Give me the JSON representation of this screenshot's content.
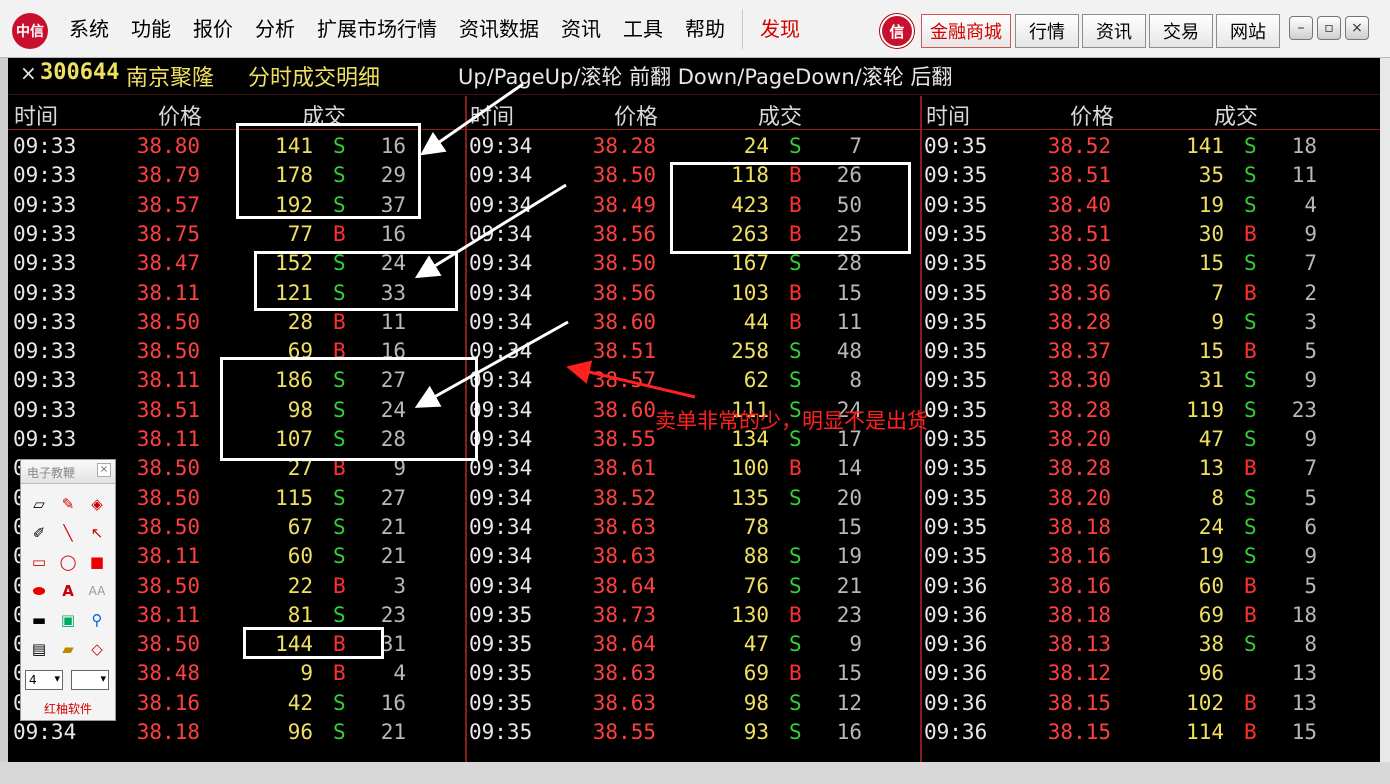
{
  "menubar": {
    "logo": "中信",
    "items": [
      "系统",
      "功能",
      "报价",
      "分析",
      "扩展市场行情",
      "资讯数据",
      "资讯",
      "工具",
      "帮助"
    ],
    "discover": "发现",
    "red_logo": "信",
    "buttons": [
      "金融商城",
      "行情",
      "资讯",
      "交易",
      "网站"
    ],
    "window_controls": [
      "minimize-icon",
      "maximize-icon",
      "close-icon"
    ]
  },
  "panel": {
    "close": "×",
    "stock_code": "300644",
    "stock_name": "南京聚隆",
    "title": "分时成交明细",
    "hint": "Up/PageUp/滚轮 前翻 Down/PageDown/滚轮 后翻",
    "headers": {
      "time": "时间",
      "price": "价格",
      "volume": "成交"
    },
    "columns": [
      [
        [
          "09:33",
          "38.80",
          "141",
          "S",
          "16"
        ],
        [
          "09:33",
          "38.79",
          "178",
          "S",
          "29"
        ],
        [
          "09:33",
          "38.57",
          "192",
          "S",
          "37"
        ],
        [
          "09:33",
          "38.75",
          "77",
          "B",
          "16"
        ],
        [
          "09:33",
          "38.47",
          "152",
          "S",
          "24"
        ],
        [
          "09:33",
          "38.11",
          "121",
          "S",
          "33"
        ],
        [
          "09:33",
          "38.50",
          "28",
          "B",
          "11"
        ],
        [
          "09:33",
          "38.50",
          "69",
          "B",
          "16"
        ],
        [
          "09:33",
          "38.11",
          "186",
          "S",
          "27"
        ],
        [
          "09:33",
          "38.51",
          "98",
          "S",
          "24"
        ],
        [
          "09:33",
          "38.11",
          "107",
          "S",
          "28"
        ],
        [
          "09:33",
          "38.50",
          "27",
          "B",
          "9"
        ],
        [
          "09:33",
          "38.50",
          "115",
          "S",
          "27"
        ],
        [
          "09:33",
          "38.50",
          "67",
          "S",
          "21"
        ],
        [
          "09:33",
          "38.11",
          "60",
          "S",
          "21"
        ],
        [
          "09:33",
          "38.50",
          "22",
          "B",
          "3"
        ],
        [
          "09:33",
          "38.11",
          "81",
          "S",
          "23"
        ],
        [
          "09:33",
          "38.50",
          "144",
          "B",
          "31"
        ],
        [
          "09:33",
          "38.48",
          "9",
          "B",
          "4"
        ],
        [
          "09:33",
          "38.16",
          "42",
          "S",
          "16"
        ],
        [
          "09:34",
          "38.18",
          "96",
          "S",
          "21"
        ]
      ],
      [
        [
          "09:34",
          "38.28",
          "24",
          "S",
          "7"
        ],
        [
          "09:34",
          "38.50",
          "118",
          "B",
          "26"
        ],
        [
          "09:34",
          "38.49",
          "423",
          "B",
          "50"
        ],
        [
          "09:34",
          "38.56",
          "263",
          "B",
          "25"
        ],
        [
          "09:34",
          "38.50",
          "167",
          "S",
          "28"
        ],
        [
          "09:34",
          "38.56",
          "103",
          "B",
          "15"
        ],
        [
          "09:34",
          "38.60",
          "44",
          "B",
          "11"
        ],
        [
          "09:34",
          "38.51",
          "258",
          "S",
          "48"
        ],
        [
          "09:34",
          "38.57",
          "62",
          "S",
          "8"
        ],
        [
          "09:34",
          "38.60",
          "111",
          "S",
          "24"
        ],
        [
          "09:34",
          "38.55",
          "134",
          "S",
          "17"
        ],
        [
          "09:34",
          "38.61",
          "100",
          "B",
          "14"
        ],
        [
          "09:34",
          "38.52",
          "135",
          "S",
          "20"
        ],
        [
          "09:34",
          "38.63",
          "78",
          "",
          "15"
        ],
        [
          "09:34",
          "38.63",
          "88",
          "S",
          "19"
        ],
        [
          "09:34",
          "38.64",
          "76",
          "S",
          "21"
        ],
        [
          "09:35",
          "38.73",
          "130",
          "B",
          "23"
        ],
        [
          "09:35",
          "38.64",
          "47",
          "S",
          "9"
        ],
        [
          "09:35",
          "38.63",
          "69",
          "B",
          "15"
        ],
        [
          "09:35",
          "38.63",
          "98",
          "S",
          "12"
        ],
        [
          "09:35",
          "38.55",
          "93",
          "S",
          "16"
        ]
      ],
      [
        [
          "09:35",
          "38.52",
          "141",
          "S",
          "18"
        ],
        [
          "09:35",
          "38.51",
          "35",
          "S",
          "11"
        ],
        [
          "09:35",
          "38.40",
          "19",
          "S",
          "4"
        ],
        [
          "09:35",
          "38.51",
          "30",
          "B",
          "9"
        ],
        [
          "09:35",
          "38.30",
          "15",
          "S",
          "7"
        ],
        [
          "09:35",
          "38.36",
          "7",
          "B",
          "2"
        ],
        [
          "09:35",
          "38.28",
          "9",
          "S",
          "3"
        ],
        [
          "09:35",
          "38.37",
          "15",
          "B",
          "5"
        ],
        [
          "09:35",
          "38.30",
          "31",
          "S",
          "9"
        ],
        [
          "09:35",
          "38.28",
          "119",
          "S",
          "23"
        ],
        [
          "09:35",
          "38.20",
          "47",
          "S",
          "9"
        ],
        [
          "09:35",
          "38.28",
          "13",
          "B",
          "7"
        ],
        [
          "09:35",
          "38.20",
          "8",
          "S",
          "5"
        ],
        [
          "09:35",
          "38.18",
          "24",
          "S",
          "6"
        ],
        [
          "09:35",
          "38.16",
          "19",
          "S",
          "9"
        ],
        [
          "09:36",
          "38.16",
          "60",
          "B",
          "5"
        ],
        [
          "09:36",
          "38.18",
          "69",
          "B",
          "18"
        ],
        [
          "09:36",
          "38.13",
          "38",
          "S",
          "8"
        ],
        [
          "09:36",
          "38.12",
          "96",
          "",
          "13"
        ],
        [
          "09:36",
          "38.15",
          "102",
          "B",
          "13"
        ],
        [
          "09:36",
          "38.15",
          "114",
          "B",
          "15"
        ]
      ]
    ],
    "annotation": "卖单非常的少，明显不是出货"
  },
  "toolbox": {
    "title": "电子教鞭",
    "close": "×",
    "tools": [
      "eraser-icon",
      "pen-icon",
      "fill-icon",
      "marker-icon",
      "line-icon",
      "arrow-icon",
      "rect-icon",
      "ellipse-icon",
      "filled-rect-icon",
      "filled-ellipse-icon",
      "text-icon",
      "font-size-icon",
      "color-icon",
      "screen-icon",
      "zoom-icon",
      "save-icon",
      "open-icon",
      "diamond-icon"
    ],
    "line_width": "4",
    "brand": "红柚软件"
  },
  "colors": {
    "price": "#ff4040",
    "volume": "#f0e060",
    "sell": "#33d133",
    "buy": "#ff3030",
    "annotation": "#ff2020"
  }
}
